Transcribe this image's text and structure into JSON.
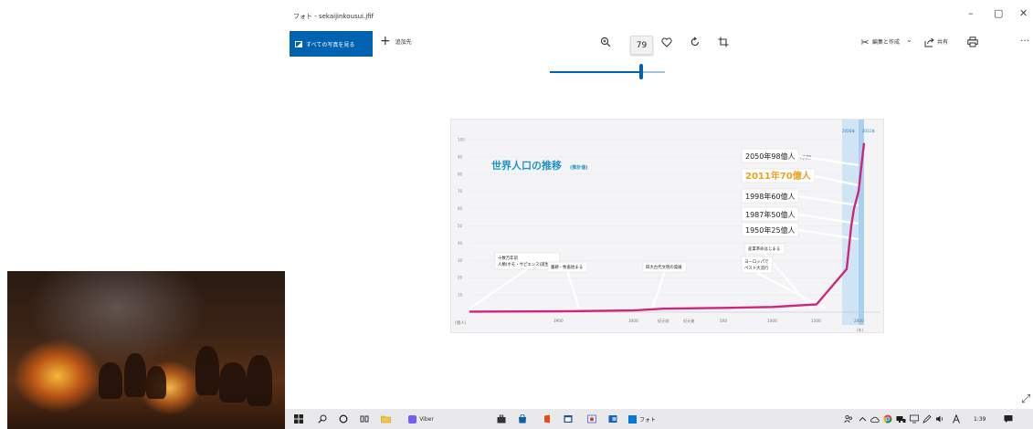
{
  "window": {
    "title": "フォト - sekaijinkousui.jfif",
    "minimize_glyph": "–",
    "maximize_glyph": "▢",
    "close_glyph": "✕"
  },
  "toolbar": {
    "all_photos_label": "すべての写真を見る",
    "add_label": "追加先",
    "zoom_value": "79",
    "edit_create_label": "編集と作成",
    "share_label": "共有",
    "more_glyph": "…",
    "zoom_percent": 79
  },
  "chart": {
    "title": "世界人口の推移",
    "title_note": "(推計値)",
    "y_unit": "(億人)",
    "y_ticks": [
      "100",
      "90",
      "80",
      "70",
      "60",
      "50",
      "40",
      "30",
      "20",
      "10"
    ],
    "x_ticks": [
      "3900",
      "3000",
      "紀元前",
      "紀元後",
      "500",
      "1000",
      "1500",
      "2000"
    ],
    "x_unit": "(年)",
    "header_tags": [
      "2050年",
      "2011年"
    ],
    "events": [
      {
        "label_1": "十数万年前",
        "label_2": "人類(ホモ・サピエンス)誕生"
      },
      {
        "label_1": "農耕・牧畜始まる"
      },
      {
        "label_1": "四大古代文明の発展"
      },
      {
        "label_1": "産業革命はじまる"
      },
      {
        "label_1": "ヨーロッパで",
        "label_2": "ペスト大流行"
      }
    ],
    "callouts": [
      {
        "year": "2050年98億人",
        "note": "(予測)"
      },
      {
        "year": "2011年70億人"
      },
      {
        "year": "1998年60億人"
      },
      {
        "year": "1987年50億人"
      },
      {
        "year": "1950年25億人"
      }
    ]
  },
  "chart_data": {
    "type": "line",
    "title": "世界人口の推移",
    "ylabel": "(億人)",
    "xlabel": "(年)",
    "ylim": [
      0,
      100
    ],
    "series": [
      {
        "x": [
          "3900",
          "3000",
          "紀元前",
          "紀元後",
          "500",
          "1000",
          "1500",
          "1950",
          "1987",
          "1998",
          "2011",
          "2050"
        ],
        "values": [
          0.3,
          0.5,
          1.0,
          2.0,
          2.5,
          3.0,
          4.5,
          25,
          50,
          60,
          70,
          98
        ]
      }
    ]
  },
  "taskbar": {
    "viber_label": "Viber",
    "photos_label": "フォト",
    "time": "1:39"
  },
  "colors": {
    "accent": "#0063b1",
    "chart_line": "#d0257a",
    "highlight_text": "#f0a020"
  }
}
